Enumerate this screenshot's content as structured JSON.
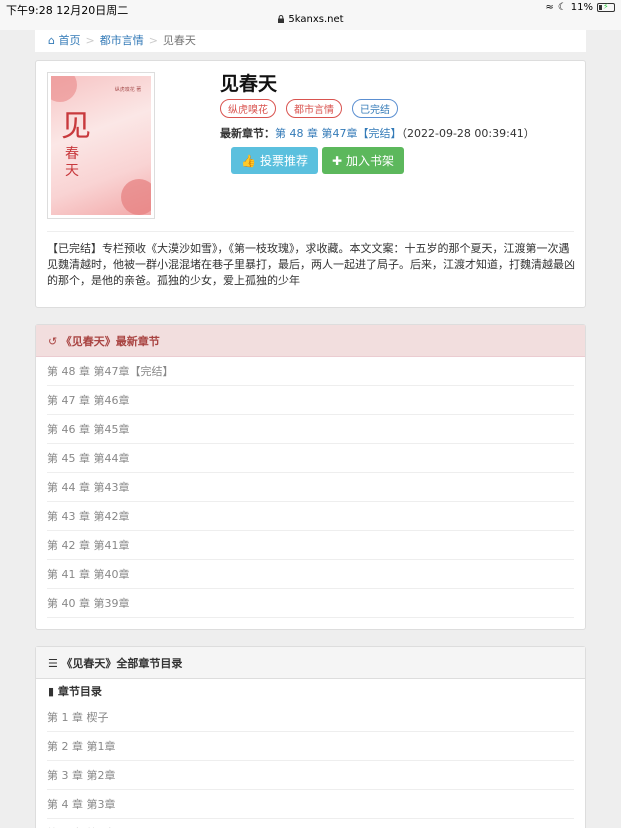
{
  "status": {
    "time": "下午9:28  12月20日周二",
    "url": "5kanxs.net",
    "battery": "11%"
  },
  "breadcrumb": {
    "home": "首页",
    "category": "都市言情",
    "current": "见春天"
  },
  "book": {
    "title": "见春天",
    "tags": [
      "纵虎嗅花",
      "都市言情",
      "已完结"
    ],
    "latest_label": "最新章节：",
    "latest_link": "第 48 章 第47章【完结】",
    "latest_time": "（2022-09-28 00:39:41）",
    "vote_button": "投票推荐",
    "shelf_button": "加入书架",
    "description": "【已完结】专栏预收《大漠沙如雪》，《第一枝玫瑰》，求收藏。本文文案：十五岁的那个夏天，江渡第一次遇见魏清越时，他被一群小混混堵在巷子里暴打，最后，两人一起进了局子。后来，江渡才知道，打魏清越最凶的那个，是他的亲爸。孤独的少女，爱上孤独的少年",
    "cover": {
      "big": "见",
      "small": "春天",
      "author": "纵虎嗅花 著"
    }
  },
  "latest_panel": {
    "title": "《见春天》最新章节",
    "chapters": [
      "第 48 章 第47章【完结】",
      "第 47 章 第46章",
      "第 46 章 第45章",
      "第 45 章 第44章",
      "第 44 章 第43章",
      "第 43 章 第42章",
      "第 42 章 第41章",
      "第 41 章 第40章",
      "第 40 章 第39章"
    ]
  },
  "all_panel": {
    "title": "《见春天》全部章节目录",
    "subtitle": "章节目录",
    "chapters": [
      "第 1 章 楔子",
      "第 2 章 第1章",
      "第 3 章 第2章",
      "第 4 章 第3章",
      "第 5 章 第4章"
    ]
  }
}
